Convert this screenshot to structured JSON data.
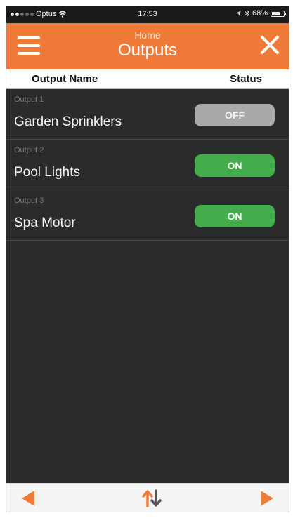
{
  "status_bar": {
    "carrier": "Optus",
    "time": "17:53",
    "battery": "68%"
  },
  "header": {
    "subtitle": "Home",
    "title": "Outputs"
  },
  "columns": {
    "name": "Output Name",
    "status": "Status"
  },
  "outputs": [
    {
      "label": "Output 1",
      "name": "Garden Sprinklers",
      "state": "OFF"
    },
    {
      "label": "Output 2",
      "name": "Pool Lights",
      "state": "ON"
    },
    {
      "label": "Output 3",
      "name": "Spa Motor",
      "state": "ON"
    }
  ],
  "icons": {
    "menu": "hamburger-menu-icon",
    "close": "close-icon",
    "prev": "arrow-left-icon",
    "sort": "sort-arrows-icon",
    "next": "arrow-right-icon"
  },
  "colors": {
    "accent": "#f07b38",
    "on": "#42ad4a",
    "off": "#a9a9a9",
    "background": "#2c2b2b"
  }
}
